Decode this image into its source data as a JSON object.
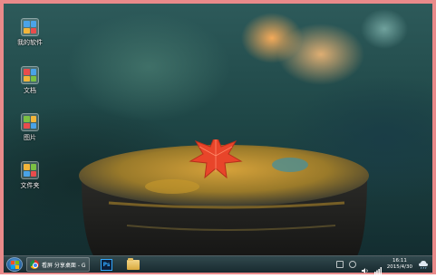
{
  "desktop": {
    "icons": [
      {
        "label": "我的软件",
        "icon": "software-folder-icon",
        "colors": [
          "#4aa3e8",
          "#4aa3e8",
          "#f2b53a",
          "#e94c4c"
        ]
      },
      {
        "label": "文档",
        "icon": "documents-folder-icon",
        "colors": [
          "#e94c4c",
          "#4aa3e8",
          "#f2b53a",
          "#7bc043"
        ]
      },
      {
        "label": "图片",
        "icon": "pictures-folder-icon",
        "colors": [
          "#7bc043",
          "#f2b53a",
          "#e94c4c",
          "#4aa3e8"
        ]
      },
      {
        "label": "文件夹",
        "icon": "folder-icon",
        "colors": [
          "#f2b53a",
          "#7bc043",
          "#4aa3e8",
          "#e94c4c"
        ]
      }
    ]
  },
  "taskbar": {
    "start_icon": "windows-start-icon",
    "tasks": [
      {
        "label": "看屏 分享桌面 - G...",
        "icon": "chrome-icon"
      },
      {
        "label": "Ps",
        "icon": "photoshop-icon"
      },
      {
        "label": "",
        "icon": "file-explorer-icon"
      }
    ],
    "clock": {
      "time": "16:11",
      "date": "2015/4/30"
    },
    "tray_icons": [
      "display-icon",
      "sync-icon",
      "volume-icon",
      "network-icon",
      "weather-icon"
    ]
  },
  "colors": {
    "frame": "#e98a8a",
    "taskbar": "#1f3a3f",
    "leaf": "#e8452a"
  }
}
